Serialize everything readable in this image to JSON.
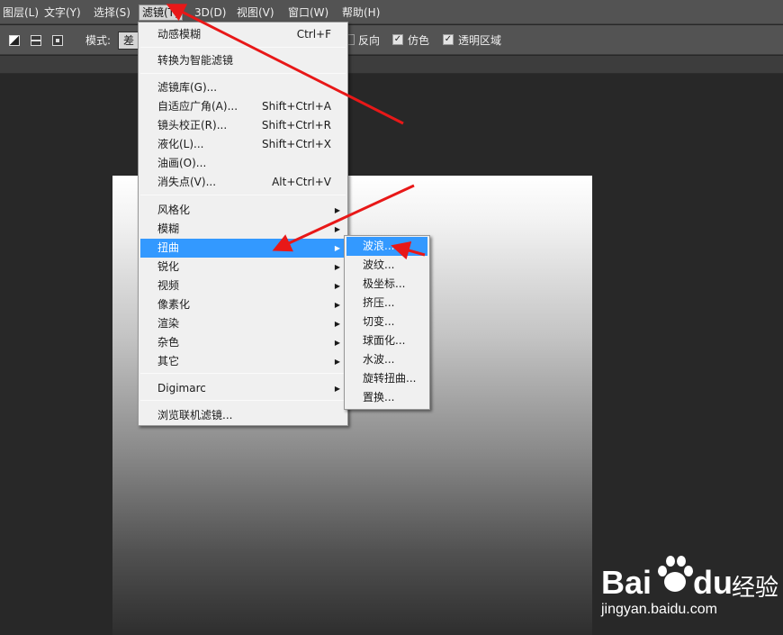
{
  "menubar": {
    "items": [
      {
        "label": "图层(L)"
      },
      {
        "label": "文字(Y)"
      },
      {
        "label": "选择(S)"
      },
      {
        "label": "滤镜(T)"
      },
      {
        "label": "3D(D)"
      },
      {
        "label": "视图(V)"
      },
      {
        "label": "窗口(W)"
      },
      {
        "label": "帮助(H)"
      }
    ]
  },
  "options": {
    "mode_label": "模式:",
    "mode_value": "差",
    "reverse_label": "反向",
    "dither_label": "仿色",
    "dither_checked": true,
    "transparency_label": "透明区域",
    "transparency_checked": true
  },
  "filter_menu": {
    "items": [
      {
        "label": "动感模糊",
        "shortcut": "Ctrl+F"
      },
      {
        "label": "转换为智能滤镜"
      },
      {
        "label": "滤镜库(G)..."
      },
      {
        "label": "自适应广角(A)...",
        "shortcut": "Shift+Ctrl+A"
      },
      {
        "label": "镜头校正(R)...",
        "shortcut": "Shift+Ctrl+R"
      },
      {
        "label": "液化(L)...",
        "shortcut": "Shift+Ctrl+X"
      },
      {
        "label": "油画(O)..."
      },
      {
        "label": "消失点(V)...",
        "shortcut": "Alt+Ctrl+V"
      },
      {
        "label": "风格化"
      },
      {
        "label": "模糊"
      },
      {
        "label": "扭曲"
      },
      {
        "label": "锐化"
      },
      {
        "label": "视频"
      },
      {
        "label": "像素化"
      },
      {
        "label": "渲染"
      },
      {
        "label": "杂色"
      },
      {
        "label": "其它"
      },
      {
        "label": "Digimarc"
      },
      {
        "label": "浏览联机滤镜..."
      }
    ],
    "submenu_arrow": "▶"
  },
  "distort_submenu": {
    "items": [
      {
        "label": "波浪..."
      },
      {
        "label": "波纹..."
      },
      {
        "label": "极坐标..."
      },
      {
        "label": "挤压..."
      },
      {
        "label": "切变..."
      },
      {
        "label": "球面化..."
      },
      {
        "label": "水波..."
      },
      {
        "label": "旋转扭曲..."
      },
      {
        "label": "置换..."
      }
    ]
  },
  "annotations": {
    "arrow_color": "#e81818"
  },
  "watermark": {
    "logo_text_1": "Bai",
    "logo_text_2": "du",
    "brand_cn": "经验",
    "url": "jingyan.baidu.com"
  },
  "colors": {
    "highlight": "#3399ff",
    "menu_bg": "#f0f0f0",
    "chrome_bg": "#535353",
    "workspace_bg": "#282828"
  }
}
